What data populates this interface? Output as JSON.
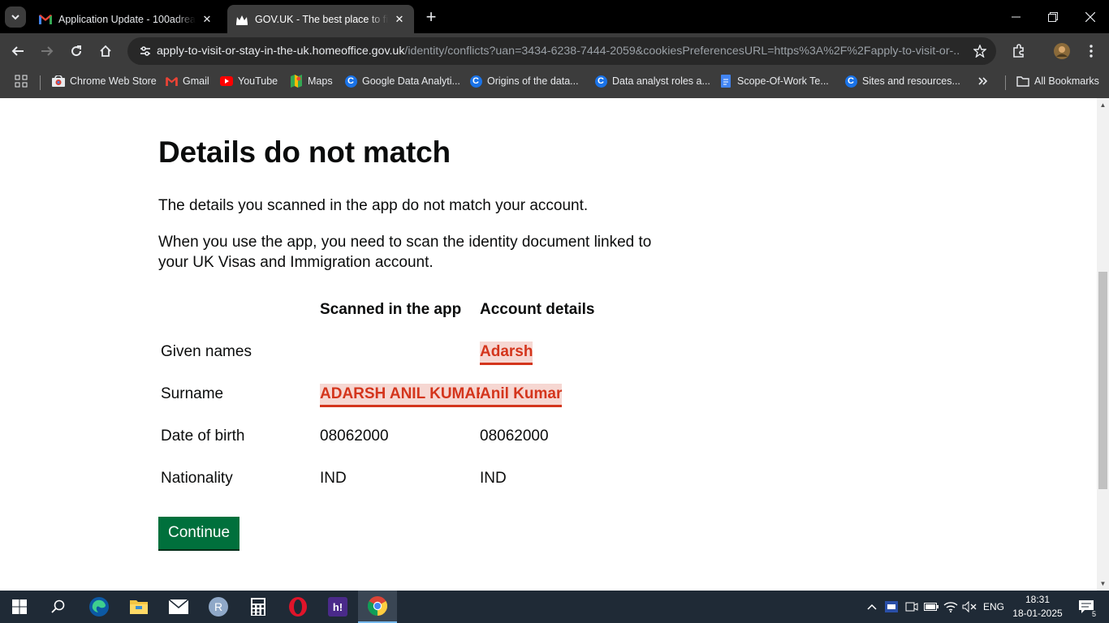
{
  "browser": {
    "tabs": [
      {
        "title": "Application Update - 100adrea",
        "favicon": "gmail-icon"
      },
      {
        "title": "GOV.UK - The best place to find",
        "favicon": "govuk-crown-icon"
      }
    ],
    "url_host": "apply-to-visit-or-stay-in-the-uk.homeoffice.gov.uk",
    "url_path": "/identity/conflicts?uan=3434-6238-7444-2059&cookiesPreferencesURL=https%3A%2F%2Fapply-to-visit-or-...",
    "bookmarks": [
      {
        "label": "Chrome Web Store",
        "icon": "chrome-web-store-icon"
      },
      {
        "label": "Gmail",
        "icon": "gmail-icon"
      },
      {
        "label": "YouTube",
        "icon": "youtube-icon"
      },
      {
        "label": "Maps",
        "icon": "maps-icon"
      },
      {
        "label": "Google Data Analyti...",
        "icon": "coursera-icon"
      },
      {
        "label": "Origins of the data...",
        "icon": "coursera-icon"
      },
      {
        "label": "Data analyst roles a...",
        "icon": "coursera-icon"
      },
      {
        "label": "Scope-Of-Work Te...",
        "icon": "docs-icon"
      },
      {
        "label": "Sites and resources...",
        "icon": "coursera-icon"
      }
    ],
    "all_bookmarks_label": "All Bookmarks"
  },
  "page": {
    "heading": "Details do not match",
    "intro": "The details you scanned in the app do not match your account.",
    "instruction": "When you use the app, you need to scan the identity document linked to your UK Visas and Immigration account.",
    "table": {
      "headers": [
        "Scanned in the app",
        "Account details"
      ],
      "rows": [
        {
          "label": "Given names",
          "scanned": "",
          "account": "Adarsh",
          "scanned_mismatch": false,
          "account_mismatch": true
        },
        {
          "label": "Surname",
          "scanned": "ADARSH ANIL KUMAR",
          "account": "Anil Kumar",
          "scanned_mismatch": true,
          "account_mismatch": true
        },
        {
          "label": "Date of birth",
          "scanned": "08062000",
          "account": "08062000",
          "scanned_mismatch": false,
          "account_mismatch": false
        },
        {
          "label": "Nationality",
          "scanned": "IND",
          "account": "IND",
          "scanned_mismatch": false,
          "account_mismatch": false
        }
      ]
    },
    "continue_label": "Continue"
  },
  "taskbar": {
    "apps": [
      "start-icon",
      "search-icon",
      "edge-icon",
      "file-explorer-icon",
      "mail-icon",
      "r-app-icon",
      "calculator-icon",
      "opera-icon",
      "hi-app-icon",
      "chrome-icon"
    ],
    "language": "ENG",
    "time": "18:31",
    "date": "18-01-2025",
    "notification_count": "5"
  },
  "colors": {
    "govuk_green": "#00703c",
    "mismatch_red": "#d4351c",
    "mismatch_bg": "#f6d7d2"
  }
}
